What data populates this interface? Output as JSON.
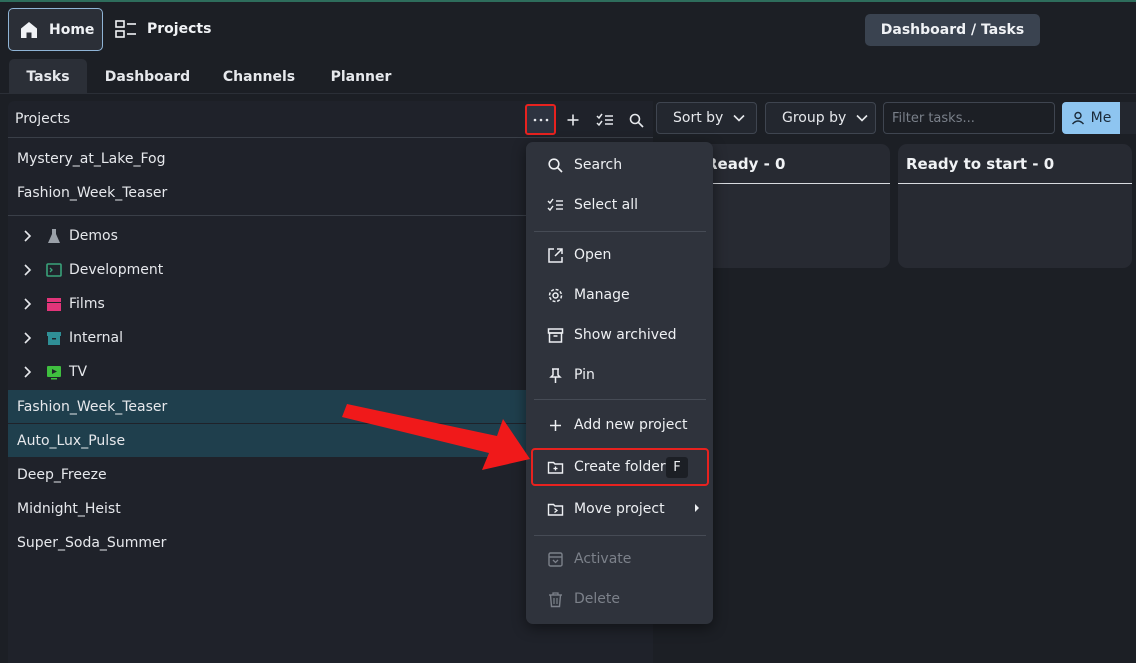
{
  "topbar": {
    "home_label": "Home",
    "projects_label": "Projects",
    "dashboard_tasks_label": "Dashboard / Tasks"
  },
  "tabs": [
    {
      "label": "Tasks",
      "active": true
    },
    {
      "label": "Dashboard",
      "active": false
    },
    {
      "label": "Channels",
      "active": false
    },
    {
      "label": "Planner",
      "active": false
    }
  ],
  "projects_panel": {
    "title": "Projects",
    "pinned": [
      "Mystery_at_Lake_Fog",
      "Fashion_Week_Teaser"
    ],
    "folders": [
      {
        "label": "Demos",
        "icon": "flask-icon",
        "color": "#9aa0a8"
      },
      {
        "label": "Development",
        "icon": "terminal-icon",
        "color": "#3aa37a"
      },
      {
        "label": "Films",
        "icon": "clapperboard-icon",
        "color": "#e2357a"
      },
      {
        "label": "Internal",
        "icon": "archive-icon",
        "color": "#2f8f96"
      },
      {
        "label": "TV",
        "icon": "tv-play-icon",
        "color": "#3fbf3f"
      }
    ],
    "projects": [
      {
        "label": "Fashion_Week_Teaser",
        "selected": true
      },
      {
        "label": "Auto_Lux_Pulse",
        "selected": true
      },
      {
        "label": "Deep_Freeze",
        "selected": false
      },
      {
        "label": "Midnight_Heist",
        "selected": false
      },
      {
        "label": "Super_Soda_Summer",
        "selected": false
      }
    ]
  },
  "toolbar": {
    "sort_label": "Sort by",
    "group_label": "Group by",
    "filter_placeholder": "Filter tasks...",
    "me_label": "Me"
  },
  "columns": [
    {
      "title": "Ready - 0"
    },
    {
      "title": "Ready to start - 0"
    }
  ],
  "menu": {
    "items": [
      {
        "label": "Search",
        "icon": "search-icon"
      },
      {
        "label": "Select all",
        "icon": "checklist-icon"
      },
      {
        "label": "Open",
        "icon": "open-external-icon"
      },
      {
        "label": "Manage",
        "icon": "gear-icon"
      },
      {
        "label": "Show archived",
        "icon": "archive-icon"
      },
      {
        "label": "Pin",
        "icon": "pin-icon"
      },
      {
        "label": "Add new project",
        "icon": "plus-icon"
      },
      {
        "label": "Create folder",
        "icon": "folder-plus-icon",
        "shortcut": "F"
      },
      {
        "label": "Move project",
        "icon": "folder-move-icon"
      },
      {
        "label": "Activate",
        "icon": "unarchive-icon",
        "disabled": true
      },
      {
        "label": "Delete",
        "icon": "trash-icon",
        "disabled": true
      }
    ]
  },
  "colors": {
    "accent": "#8ec5f0",
    "selection": "#1f3f4d",
    "highlight_red": "#e8221f"
  }
}
